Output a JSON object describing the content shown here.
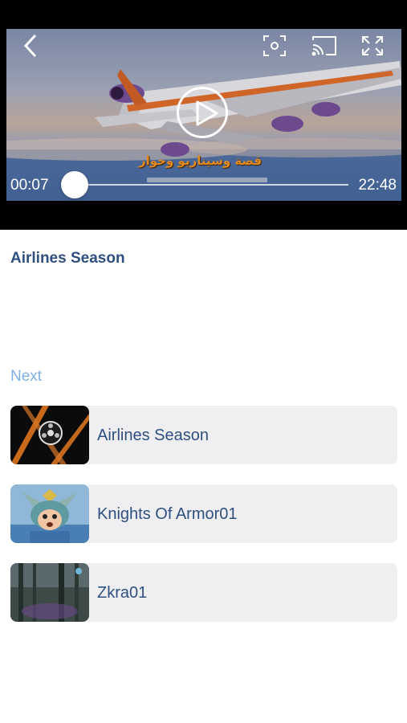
{
  "player": {
    "current_time": "00:07",
    "total_time": "22:48",
    "progress_fraction": 0.005,
    "subtitle_text": "قصة وسيناريو وحوار",
    "icons": [
      "chevron-left-icon",
      "focus-icon",
      "cast-icon",
      "fullscreen-icon",
      "play-icon"
    ]
  },
  "video": {
    "title": "Airlines Season"
  },
  "next": {
    "label": "Next",
    "items": [
      {
        "title": "Airlines Season",
        "thumb_icon": "film-reel-icon"
      },
      {
        "title": "Knights Of Armor01",
        "thumb_icon": "armored-knight-icon"
      },
      {
        "title": "Zkra01",
        "thumb_icon": "forest-scene-icon"
      }
    ]
  },
  "colors": {
    "title_blue": "#2e4f7f",
    "next_label_blue": "#7fb0e2",
    "list_bg": "#efeff1"
  }
}
